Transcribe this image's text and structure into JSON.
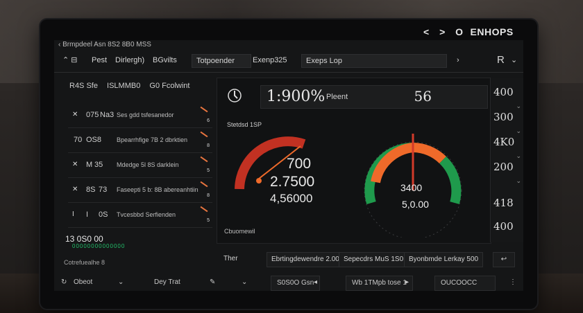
{
  "window": {
    "title": "ENHOPS",
    "nav_back": "<",
    "nav_forward": ">",
    "logo_glyph": "O"
  },
  "titlebar": {
    "text": "Brmpdeel Asn 8S2 8B0 MSS"
  },
  "menubar": {
    "items": [
      {
        "label": "Pest"
      },
      {
        "label": "Dirlergh)"
      },
      {
        "label": "BGvilts"
      },
      {
        "label": "Totpoender"
      },
      {
        "label": "Exenp325"
      },
      {
        "label": "Exeps Lop"
      }
    ],
    "user": "R"
  },
  "left_panel": {
    "header": [
      "R4S Sfe",
      "ISLMMB0",
      "G0 Fcolwint"
    ],
    "rows": [
      {
        "id": "075",
        "name": "Na3",
        "desc": "Ses gdd tsfesanedor",
        "count": "6"
      },
      {
        "id": "70",
        "name": "OS8",
        "desc": "Bpearrhfige 7B  2 dbrktien",
        "count": "8"
      },
      {
        "id": "M",
        "name": "35",
        "desc": "Mdedge 5l 8S darklein",
        "count": "5"
      },
      {
        "id": "8S",
        "name": "73",
        "desc": "Faseepti 5 b: 8B abereanhtiin",
        "count": "8"
      },
      {
        "id": "I",
        "name": "0S",
        "desc": "Tvcesbbd Serfienden",
        "count": "5"
      }
    ],
    "total": "13 0S0 00",
    "total_sub": "00000000000000",
    "status": "Cotrefuealhe 8"
  },
  "dashboard": {
    "big_percent": "1:900%",
    "plant_label": "Pleent",
    "top_value": "56",
    "speed_label": "Stetdsd 1SP",
    "gauge1": {
      "v1": "700",
      "v2": "2.7500",
      "v3": "4,56000",
      "level": 0.65
    },
    "gauge2": {
      "v1": "3400",
      "v2": "5,0.00",
      "level": 0.5
    },
    "status": "Cbuomewil"
  },
  "right_column": {
    "values": [
      "400",
      "300",
      "4K0",
      "200",
      "418",
      "400"
    ]
  },
  "bottom_row": {
    "label": "Ther",
    "field1": "Ebrtingdewendre 2.00",
    "field2": "Sepecdrs MuS 1S0",
    "field3": "Byonbmde Lerkay 500",
    "action": "↩"
  },
  "footer": {
    "item1": "Obeot",
    "item2": "Dey Trat",
    "item3": "S0S0O Gsn",
    "item4": "Wb 1TMpb tose 1",
    "item5": "OUCOOCC"
  },
  "colors": {
    "accent": "#e9753f",
    "red": "#d23a2a",
    "green": "#22a85a",
    "orange": "#ef6a2a"
  }
}
